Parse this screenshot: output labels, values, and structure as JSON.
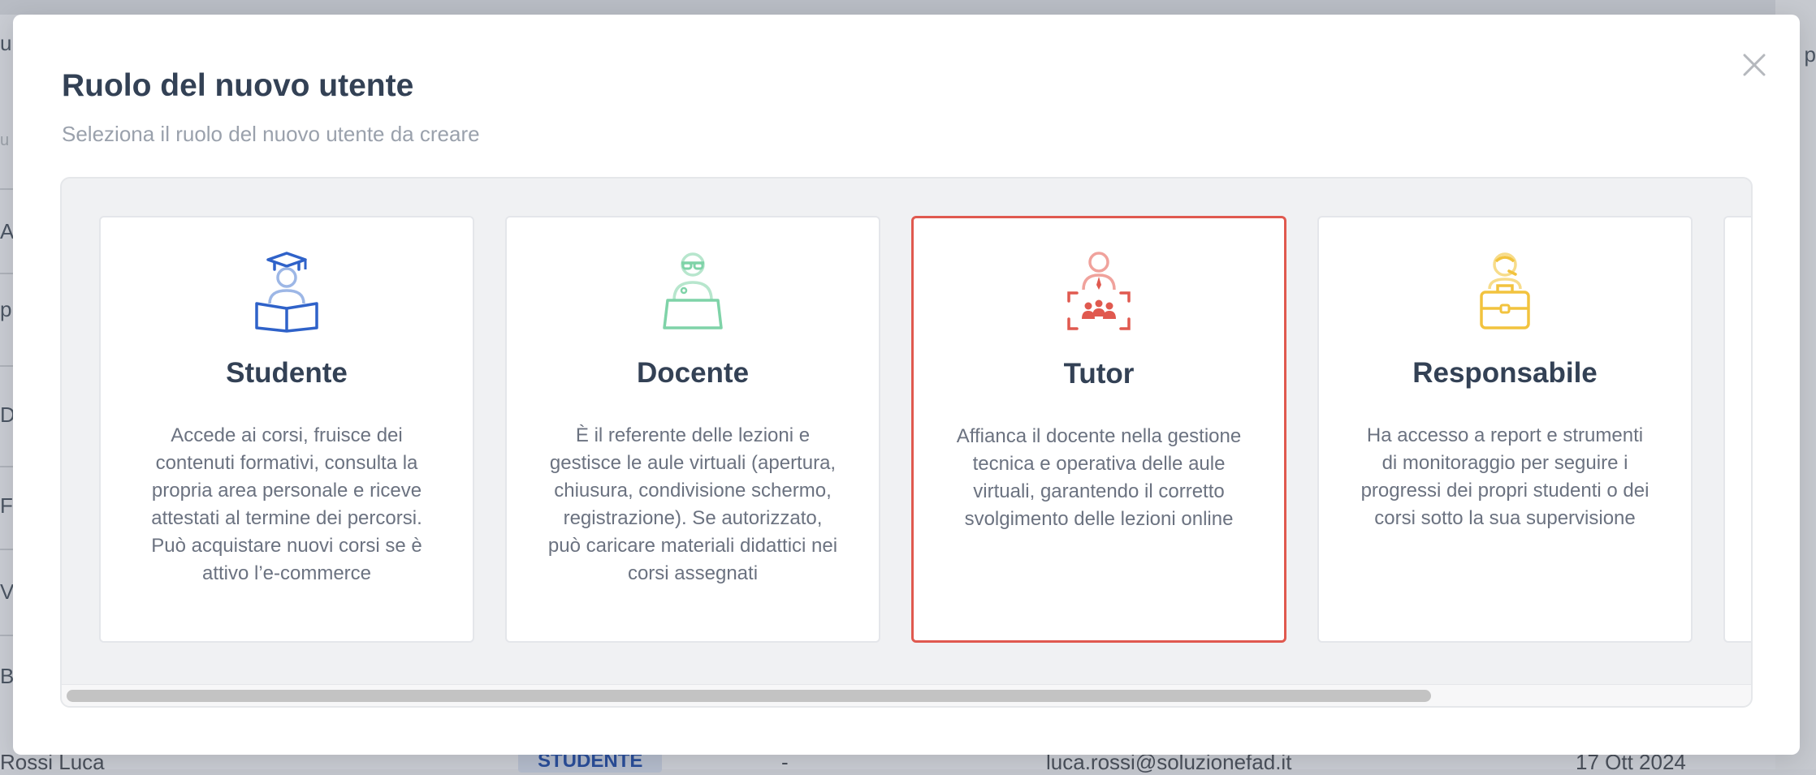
{
  "background": {
    "side_letters": [
      "u",
      "u",
      "A",
      "p",
      "D",
      "F",
      "V",
      "B"
    ],
    "right_text": "p",
    "visible_row": {
      "name": "Rossi Luca",
      "role_badge": "STUDENTE",
      "dash": "-",
      "email": "luca.rossi@soluzionefad.it",
      "date": "17 Ott 2024"
    }
  },
  "modal": {
    "title": "Ruolo del nuovo utente",
    "subtitle": "Seleziona il ruolo del nuovo utente da creare",
    "close_label": "×",
    "selected_index": 2,
    "roles": [
      {
        "title": "Studente",
        "icon": "student-reading-icon",
        "color": "#2f62c9",
        "description": "Accede ai corsi, fruisce dei contenuti formativi, consulta la propria area personale e riceve attestati al termine dei percorsi. Può acquistare nuovi corsi se è attivo l’e-commerce"
      },
      {
        "title": "Docente",
        "icon": "teacher-laptop-icon",
        "color": "#7fd3a8",
        "description": "È il referente delle lezioni e gestisce le aule virtuali (apertura, chiusura, condivisione schermo, registrazione). Se autorizzato, può caricare materiali didattici nei corsi assegnati"
      },
      {
        "title": "Tutor",
        "icon": "tutor-group-icon",
        "color": "#e0594f",
        "description": "Affianca il docente nella gestione tecnica e operativa delle aule virtuali, garantendo il corretto svolgimento delle lezioni online"
      },
      {
        "title": "Responsabile",
        "icon": "manager-briefcase-icon",
        "color": "#f2c33e",
        "description": "Ha accesso a report e strumenti di monitoraggio per seguire i progressi dei propri studenti o dei corsi sotto la sua supervisione"
      }
    ]
  }
}
